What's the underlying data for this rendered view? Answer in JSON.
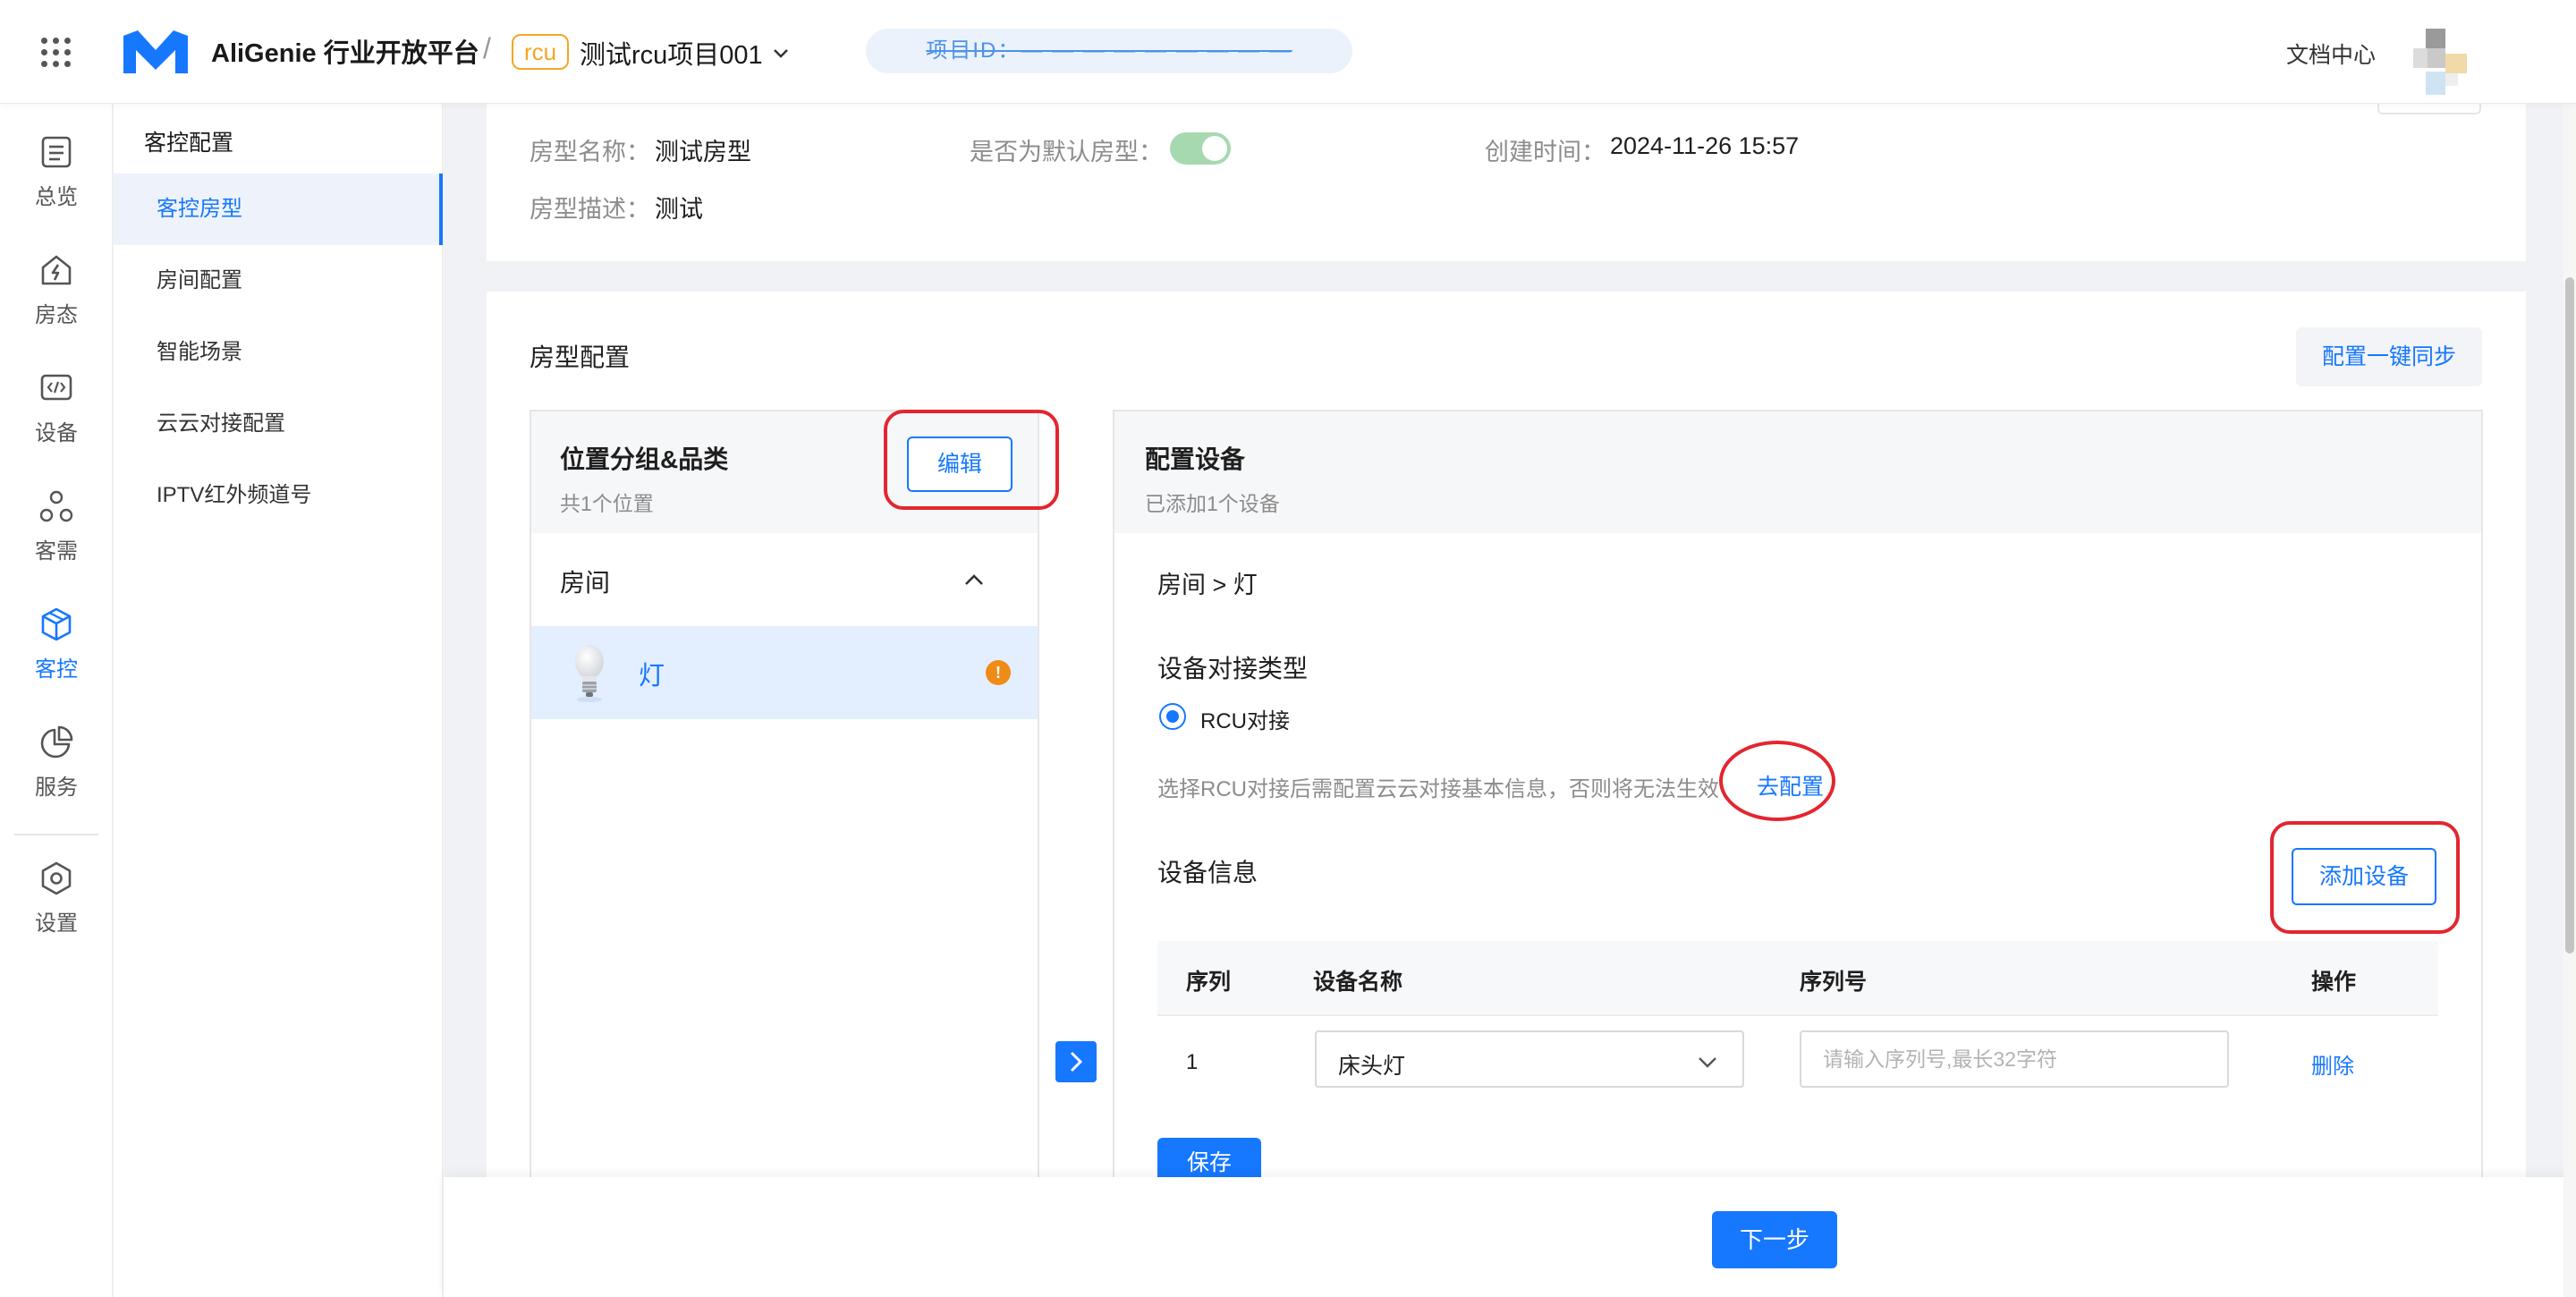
{
  "topbar": {
    "brand": "AliGenie 行业开放平台",
    "separator": "/",
    "project_tag": "rcu",
    "project_name": "测试rcu项目001",
    "project_id": "项目ID：— — — — — — — — —",
    "doc_center": "文档中心"
  },
  "rail": {
    "items": [
      {
        "label": "总览",
        "icon": "overview-icon"
      },
      {
        "label": "房态",
        "icon": "room-status-icon"
      },
      {
        "label": "设备",
        "icon": "device-icon"
      },
      {
        "label": "客需",
        "icon": "guest-needs-icon"
      },
      {
        "label": "客控",
        "icon": "guest-control-icon"
      },
      {
        "label": "服务",
        "icon": "service-icon"
      },
      {
        "label": "设置",
        "icon": "settings-icon"
      }
    ],
    "active": "客控"
  },
  "subnav": {
    "title": "客控配置",
    "items": [
      "客控房型",
      "房间配置",
      "智能场景",
      "云云对接配置",
      "IPTV红外频道号"
    ],
    "active": "客控房型"
  },
  "room_info": {
    "name_label": "房型名称：",
    "name_value": "测试房型",
    "default_label": "是否为默认房型：",
    "default_on": true,
    "created_label": "创建时间：",
    "created_value": "2024-11-26 15:57",
    "desc_label": "房型描述：",
    "desc_value": "测试"
  },
  "config": {
    "title": "房型配置",
    "sync_button": "配置一键同步",
    "left_panel": {
      "title": "位置分组&品类",
      "subtitle": "共1个位置",
      "edit_button": "编辑",
      "group": "房间",
      "item": "灯",
      "item_warning": "!"
    },
    "right_panel": {
      "title": "配置设备",
      "subtitle": "已添加1个设备",
      "breadcrumb": "房间 > 灯",
      "connect_type_title": "设备对接类型",
      "radio_label": "RCU对接",
      "hint": "选择RCU对接后需配置云云对接基本信息，否则将无法生效",
      "goto_link": "去配置",
      "device_info_title": "设备信息",
      "add_button": "添加设备",
      "table": {
        "headers": [
          "序列",
          "设备名称",
          "序列号",
          "操作"
        ],
        "rows": [
          {
            "index": "1",
            "device": "床头灯",
            "serial_placeholder": "请输入序列号,最长32字符",
            "action": "删除"
          }
        ]
      },
      "save_button": "保存"
    }
  },
  "footer": {
    "next_button": "下一步"
  },
  "colors": {
    "primary": "#1677ff",
    "annotation": "#e3262f",
    "warning": "#f08b18",
    "tag": "#f5a623"
  }
}
